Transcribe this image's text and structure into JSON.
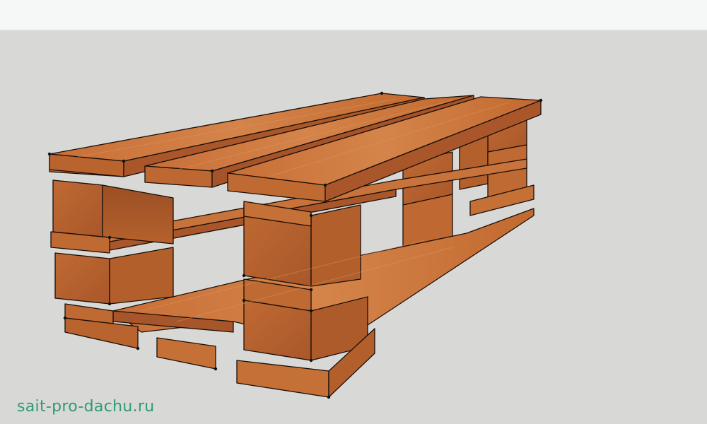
{
  "colors": {
    "background": "#d8d8d6",
    "top_strip": "#f6f7f7",
    "wood_top": "#cc773f",
    "wood_side": "#b5612d",
    "wood_dark": "#8f4a20",
    "wood_light": "#dd8f52",
    "edge": "#1a0f08",
    "watermark": "#2f9a77"
  },
  "watermark": {
    "text": "sait-pro-dachu.ru"
  }
}
